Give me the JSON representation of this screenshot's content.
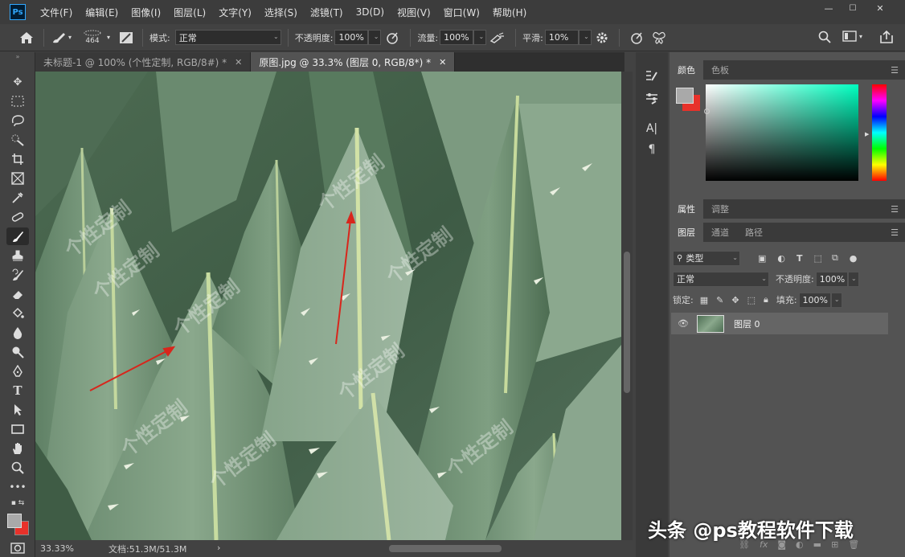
{
  "app": {
    "logo": "Ps"
  },
  "menu": [
    "文件(F)",
    "编辑(E)",
    "图像(I)",
    "图层(L)",
    "文字(Y)",
    "选择(S)",
    "滤镜(T)",
    "3D(D)",
    "视图(V)",
    "窗口(W)",
    "帮助(H)"
  ],
  "window_controls": {
    "minimize": "—",
    "maximize": "☐",
    "close": "✕"
  },
  "options": {
    "brush_size": "464",
    "mode_label": "模式:",
    "mode_value": "正常",
    "opacity_label": "不透明度:",
    "opacity_value": "100%",
    "flow_label": "流量:",
    "flow_value": "100%",
    "smooth_label": "平滑:",
    "smooth_value": "10%"
  },
  "tabs": [
    {
      "label": "未标题-1 @ 100% (个性定制, RGB/8#) *",
      "close": "✕",
      "active": false
    },
    {
      "label": "原图.jpg @ 33.3% (图层 0, RGB/8*) *",
      "close": "✕",
      "active": true
    }
  ],
  "canvas": {
    "watermark_text": "个性定制",
    "arrow_color": "#d8261c"
  },
  "status": {
    "zoom": "33.33%",
    "doc_info": "文档:51.3M/51.3M",
    "more": "›"
  },
  "panels": {
    "color": {
      "tab_active": "颜色",
      "tab_other": "色板",
      "fg_color": "#a9a9a9",
      "bg_color": "#e8312a"
    },
    "properties": {
      "tab_active": "属性",
      "tab_other": "调整"
    },
    "layers": {
      "tabs": [
        "图层",
        "通道",
        "路径"
      ],
      "filter_label": "类型",
      "blend_mode": "正常",
      "opacity_label": "不透明度:",
      "opacity_value": "100%",
      "lock_label": "锁定:",
      "fill_label": "填充:",
      "fill_value": "100%",
      "layer_name": "图层 0"
    }
  },
  "overlay_caption": "头条 @ps教程软件下载"
}
